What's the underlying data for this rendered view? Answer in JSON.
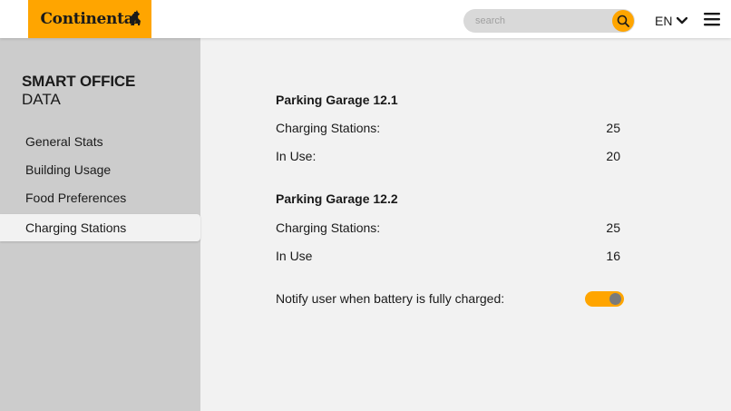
{
  "header": {
    "logo_text": "Continental",
    "search_placeholder": "search",
    "language": "EN",
    "icons": [
      "horse-logo-icon",
      "search-icon",
      "chevron-down-icon",
      "hamburger-menu-icon"
    ]
  },
  "sidebar": {
    "title": "SMART OFFICE",
    "subtitle": "DATA",
    "items": [
      {
        "label": "General Stats",
        "active": false
      },
      {
        "label": "Building Usage",
        "active": false
      },
      {
        "label": "Food Preferences",
        "active": false
      },
      {
        "label": "Charging Stations",
        "active": true
      }
    ]
  },
  "main": {
    "garages": [
      {
        "title": "Parking Garage 12.1",
        "rows": [
          {
            "label": "Charging Stations:",
            "value": "25"
          },
          {
            "label": "In Use:",
            "value": "20"
          }
        ]
      },
      {
        "title": "Parking Garage 12.2",
        "rows": [
          {
            "label": "Charging Stations:",
            "value": "25"
          },
          {
            "label": "In Use",
            "value": "16"
          }
        ]
      }
    ],
    "notify_label": "Notify user when battery is fully charged:",
    "notify_enabled": true
  },
  "colors": {
    "accent": "#ffa500",
    "sidebar_bg": "#cccccc",
    "content_bg": "#f2f2f2",
    "header_bg": "#ffffff"
  }
}
